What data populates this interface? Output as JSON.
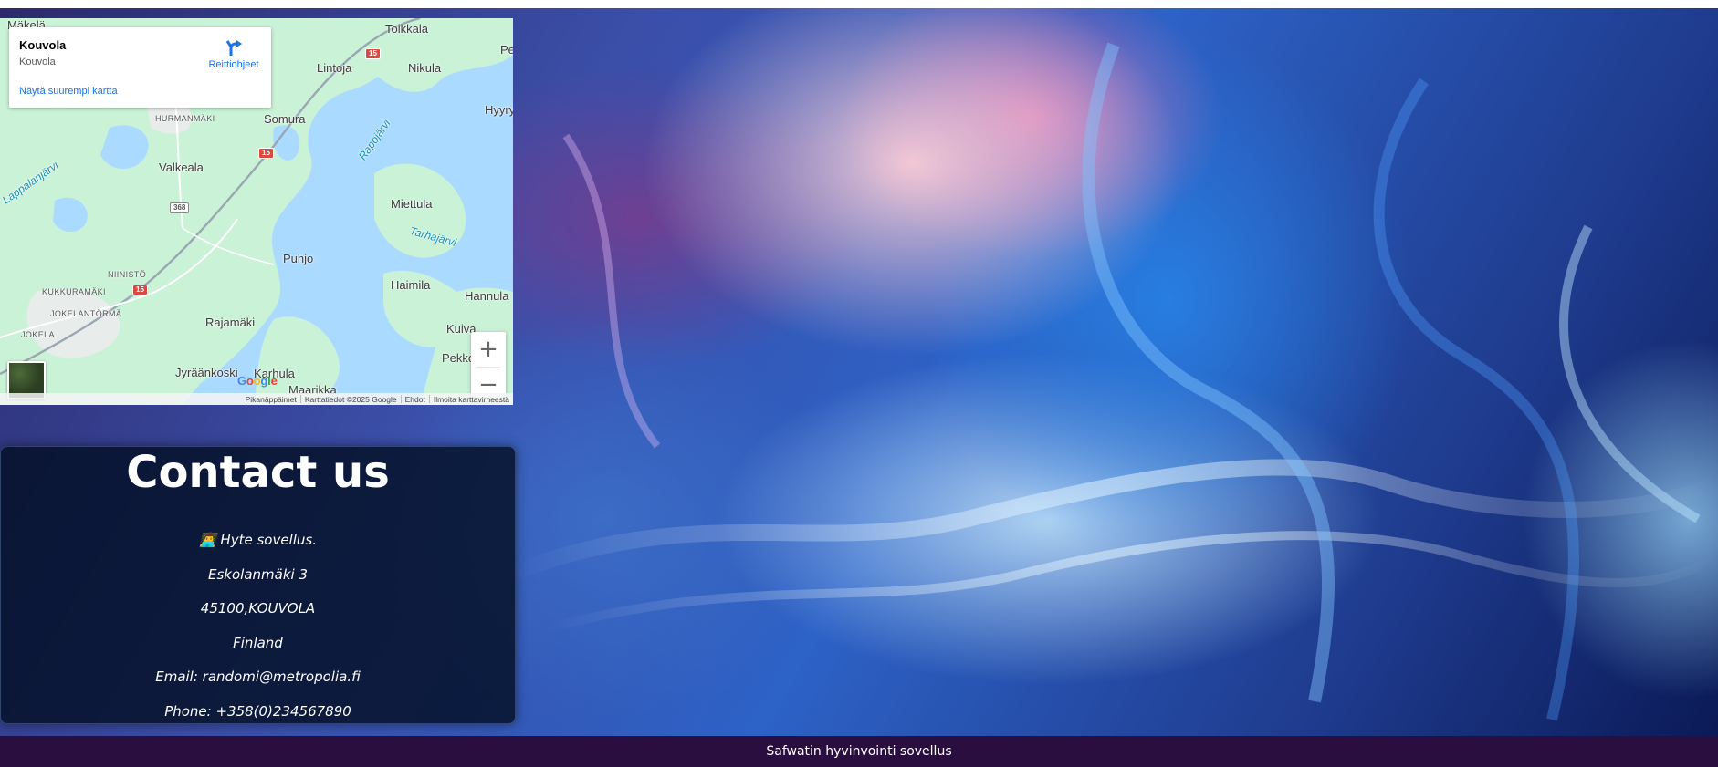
{
  "map": {
    "card": {
      "title": "Kouvola",
      "subtitle": "Kouvola",
      "directions_label": "Reittiohjeet",
      "larger_map_link": "Näytä suurempi kartta"
    },
    "places": {
      "makela": "Mäkelä",
      "toikkala": "Toikkala",
      "pe": "Pe",
      "lintoja": "Lintoja",
      "nikula": "Nikula",
      "hyyry": "Hyyry",
      "hurmanmaki": "HURMANMÄKI",
      "somura": "Somura",
      "rapojarvi": "Rapojärvi",
      "lappalanjarvi": "Lappalanjärvi",
      "valkeala": "Valkeala",
      "miettula": "Miettula",
      "tarhajarvi": "Tarhajärvi",
      "niinisto": "NIINISTÖ",
      "puhjo": "Puhjo",
      "haimila": "Haimila",
      "hannula": "Hannula",
      "kukkuramaki": "KUKKURAMÄKI",
      "jokelantorma": "JOKELANTÖRMÄ",
      "jokela": "JOKELA",
      "rajamaki": "Rajamäki",
      "kuiva": "Kuiva",
      "pekko": "Pekko",
      "jyraankoski": "Jyräänkoski",
      "karhula": "Karhula",
      "maarikka": "Maarikka"
    },
    "road_shields": {
      "r15_a": "15",
      "r15_b": "15",
      "r15_c": "15",
      "r368": "368"
    },
    "zoom_in": "+",
    "zoom_out": "−",
    "google_logo": "Google",
    "attribution": {
      "shortcuts": "Pikanäppäimet",
      "mapdata": "Karttatiedot ©2025 Google",
      "terms": "Ehdot",
      "report": "Ilmoita karttavirheestä"
    }
  },
  "contact": {
    "heading": "Contact us",
    "company": "👨‍💻 Hyte sovellus.",
    "street": "Eskolanmäki 3",
    "postal": "45100,KOUVOLA",
    "country": "Finland",
    "email": "Email: randomi@metropolia.fi",
    "phone": "Phone: +358(0)234567890"
  },
  "footer": {
    "text": "Safwatin hyvinvointi sovellus"
  },
  "colors": {
    "footer_bg": "#2a0e40",
    "link_blue": "#1a73e8",
    "water": "#aadaff",
    "land": "#c9f2d6"
  }
}
